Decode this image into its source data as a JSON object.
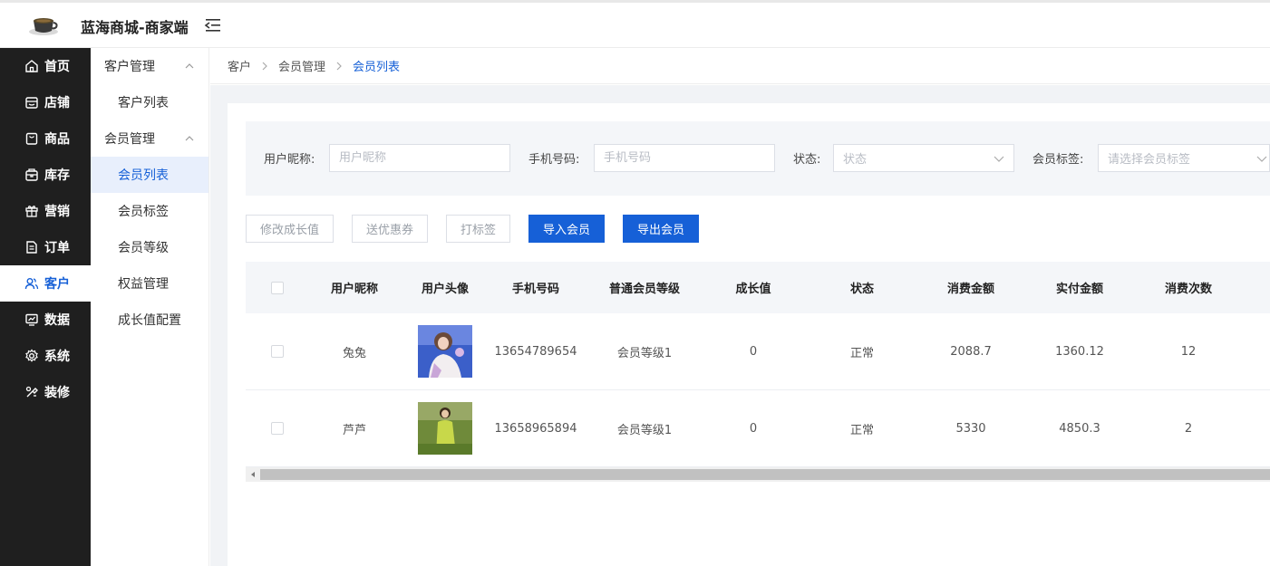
{
  "header": {
    "brand": "蓝海商城-商家端"
  },
  "nav": [
    {
      "label": "首页",
      "icon": "home-icon"
    },
    {
      "label": "店铺",
      "icon": "store-icon"
    },
    {
      "label": "商品",
      "icon": "bag-icon"
    },
    {
      "label": "库存",
      "icon": "inventory-icon"
    },
    {
      "label": "营销",
      "icon": "gift-icon"
    },
    {
      "label": "订单",
      "icon": "order-icon"
    },
    {
      "label": "客户",
      "icon": "users-icon",
      "active": true
    },
    {
      "label": "数据",
      "icon": "chart-icon"
    },
    {
      "label": "系统",
      "icon": "gear-icon"
    },
    {
      "label": "装修",
      "icon": "decorate-icon"
    }
  ],
  "subnav": {
    "group1": "客户管理",
    "group1_items": [
      "客户列表"
    ],
    "group2": "会员管理",
    "group2_items": [
      "会员列表",
      "会员标签",
      "会员等级",
      "权益管理",
      "成长值配置"
    ],
    "active": "会员列表"
  },
  "breadcrumb": [
    "客户",
    "会员管理",
    "会员列表"
  ],
  "filters": {
    "nickname_label": "用户昵称:",
    "nickname_placeholder": "用户昵称",
    "phone_label": "手机号码:",
    "phone_placeholder": "手机号码",
    "status_label": "状态:",
    "status_placeholder": "状态",
    "tag_label": "会员标签:",
    "tag_placeholder": "请选择会员标签"
  },
  "actions": {
    "modify_growth": "修改成长值",
    "send_coupon": "送优惠券",
    "tag": "打标签",
    "import": "导入会员",
    "export": "导出会员"
  },
  "table": {
    "columns": [
      "用户昵称",
      "用户头像",
      "手机号码",
      "普通会员等级",
      "成长值",
      "状态",
      "消费金额",
      "实付金额",
      "消费次数"
    ],
    "rows": [
      {
        "nickname": "兔兔",
        "phone": "13654789654",
        "level": "会员等级1",
        "growth": "0",
        "status": "正常",
        "spend": "2088.7",
        "paid": "1360.12",
        "count": "12"
      },
      {
        "nickname": "芦芦",
        "phone": "13658965894",
        "level": "会员等级1",
        "growth": "0",
        "status": "正常",
        "spend": "5330",
        "paid": "4850.3",
        "count": "2"
      }
    ]
  },
  "colors": {
    "primary": "#1660d7",
    "sidebar": "#1f1f1f",
    "panel": "#f4f6f9"
  }
}
